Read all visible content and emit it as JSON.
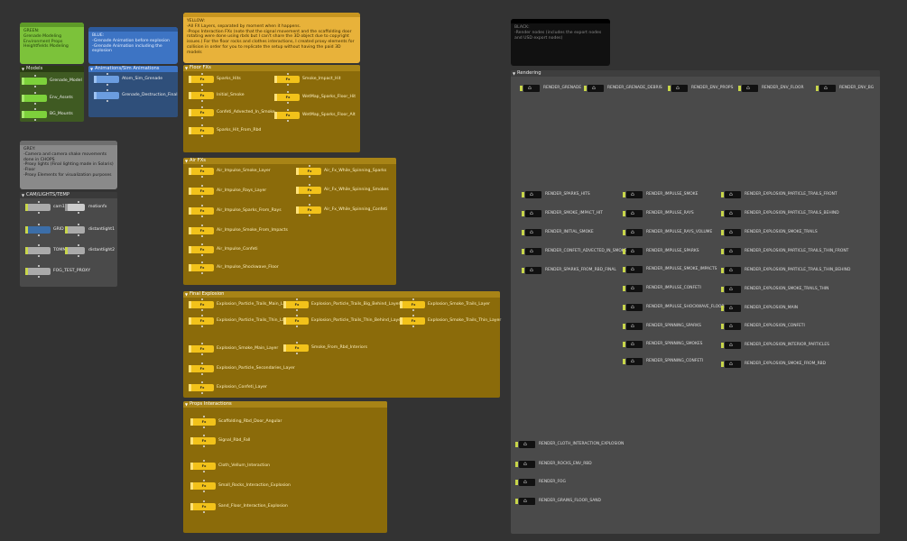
{
  "notes": {
    "green": {
      "title": "GREEN:",
      "body": "Grenade Modeling\nEnvironment Props\nHeightfields Modeling"
    },
    "blue": {
      "title": "BLUE:",
      "body": "-Grenade Animation before explosion\n-Grenade Animation including the explosion"
    },
    "yellow": {
      "title": "YELLOW:",
      "body": "-All FX Layers, separated by moment when it happens.\n-Props Interaction FXs (note that the signal movement and the scaffolding door rotating were done using rbds but I can't share the 3D object due to copyright issues.) For the floor rocks and clothes interactions, I created proxy elements for collision in order for you to replicate the setup without having the paid 3D models"
    },
    "grey": {
      "title": "GREY:",
      "body": "-Camera and camera shake movements done in CHOPS\n-Proxy lights (Final lighting made in Solaris)\n-Floor\n-Proxy Elements for visualization purposes"
    },
    "black": {
      "title": "BLACK:",
      "body": "-Render nodes (includes the export nodes and USD export nodes)"
    }
  },
  "boxes": {
    "models": {
      "title": "Models",
      "nodes": [
        "Grenade_Model",
        "Env_Assets",
        "BG_Mounts"
      ]
    },
    "animations": {
      "title": "Animations/Sim Animations",
      "nodes": [
        "Atom_Sim_Grenade",
        "Grenade_Destruction_Final"
      ]
    },
    "floor_fx": {
      "title": "Floor FXs",
      "nodes": [
        "Sparks_Hits",
        "Initial_Smoke",
        "Confeti_Advected_In_Smoke",
        "Sparks_Hit_From_Rbd",
        "Smoke_Impact_Hit",
        "WetMap_Sparks_Floor_Hit",
        "WetMap_Sparks_Floor_Alt"
      ]
    },
    "air_fx": {
      "title": "Air FXs",
      "nodes": [
        "Air_Impulse_Smoke_Layer",
        "Air_Impulse_Rays_Layer",
        "Air_Impulse_Sparks_From_Rays",
        "Air_Impulse_Smoke_From_Impacts",
        "Air_Impulse_Confeti",
        "Air_Impulse_Shockwave_Floor",
        "Air_Fx_While_Spinning_Sparks",
        "Air_Fx_While_Spinning_Smokes",
        "Air_Fx_While_Spinning_Confeti"
      ]
    },
    "final_explosion": {
      "title": "Final Explosion",
      "nodes": [
        "Explosion_Particle_Trails_Main_Layer",
        "Explosion_Particle_Trails_Thin_Layer",
        "Explosion_Smoke_Main_Layer",
        "Explosion_Particle_Secondaries_Layer",
        "Explosion_Confeti_Layer",
        "Explosion_Particle_Trails_Big_Behind_Layer",
        "Explosion_Particle_Trails_Thin_Behind_Layer",
        "Smoke_From_Rbd_Interiors",
        "Explosion_Smoke_Trails_Layer",
        "Explosion_Smoke_Trails_Thin_Layer"
      ]
    },
    "props": {
      "title": "Props Interactions",
      "nodes": [
        "Scaffolding_Rbd_Door_Angular",
        "Signal_Rbd_Fall",
        "Cloth_Vellum_Interaction",
        "Small_Rocks_Interaction_Explosion",
        "Sand_Floor_Interaction_Explosion"
      ]
    },
    "cam": {
      "title": "CAM/LIGHTS/TEMP",
      "nodes": [
        "cam1",
        "motionfx",
        "GRID",
        "distantlight1",
        "TOMMY",
        "distantlight2",
        "FOG_TEST_PROXY"
      ]
    },
    "rendering": {
      "title": "Rendering",
      "row": [
        "RENDER_GRENADE",
        "RENDER_GRENADE_DEBRIS",
        "RENDER_ENV_PROPS",
        "RENDER_ENV_FLOOR",
        "RENDER_ENV_BG"
      ],
      "col1": [
        "RENDER_SPARKS_HITS",
        "RENDER_SMOKE_IMPACT_HIT",
        "RENDER_INITIAL_SMOKE",
        "RENDER_CONFETI_ADVECTED_IN_SMOKE",
        "RENDER_SPARKS_FROM_RBD_FINAL"
      ],
      "col2": [
        "RENDER_IMPULSE_SMOKE",
        "RENDER_IMPULSE_RAYS",
        "RENDER_IMPULSE_RAYS_VOLUME",
        "RENDER_IMPULSE_SPARKS",
        "RENDER_IMPULSE_SMOKE_IMPACTS",
        "RENDER_IMPULSE_CONFETI",
        "RENDER_IMPULSE_SHOCKWAVE_FLOOR",
        "RENDER_SPINNING_SPARKS",
        "RENDER_SPINNING_SMOKES",
        "RENDER_SPINNING_CONFETI"
      ],
      "col3": [
        "RENDER_EXPLOSION_PARTICLE_TRAILS_FRONT",
        "RENDER_EXPLOSION_PARTICLE_TRAILS_BEHIND",
        "RENDER_EXPLOSION_SMOKE_TRAILS",
        "RENDER_EXPLOSION_PARTICLE_TRAILS_THIN_FRONT",
        "RENDER_EXPLOSION_PARTICLE_TRAILS_THIN_BEHIND",
        "RENDER_EXPLOSION_SMOKE_TRAILS_THIN",
        "RENDER_EXPLOSION_MAIN",
        "RENDER_EXPLOSION_CONFETI",
        "RENDER_EXPLOSION_INTERIOR_PARTICLES",
        "RENDER_EXPLOSION_SMOKE_FROM_RBD"
      ],
      "col4": [
        "RENDER_CLOTH_INTERACTION_EXPLOSION",
        "RENDER_ROCKS_ENV_RBD",
        "RENDER_FOG",
        "RENDER_GRAINS_FLOOR_SAND"
      ]
    }
  },
  "fx_badge": "Fx",
  "colors": {
    "green": "#7cc23a",
    "blue": "#3d74c4",
    "yellow": "#e8b23a",
    "grey": "#8a8a8a",
    "black": "#111111",
    "fxbox": "#8b6b0a",
    "modelbox": "#3f5a22",
    "animbox": "#2f4f7a",
    "node_yellow": "#f2c21a",
    "node_green": "#7dd13b",
    "node_blue": "#6b9de0"
  }
}
